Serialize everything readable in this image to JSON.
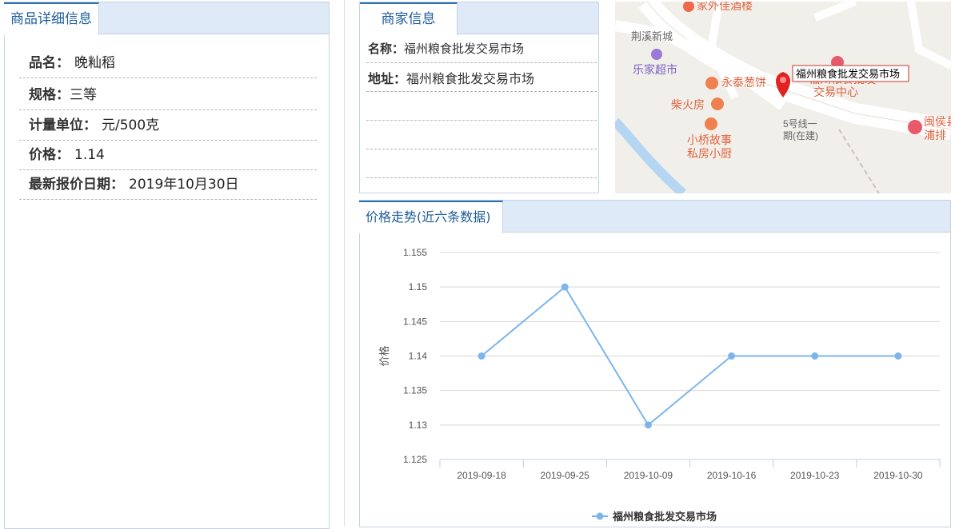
{
  "product": {
    "tab_title": "商品详细信息",
    "fields": [
      {
        "label": "品名：",
        "value": "晚籼稻"
      },
      {
        "label": "规格：",
        "value": "三等"
      },
      {
        "label": "计量单位：",
        "value": "元/500克"
      },
      {
        "label": "价格：",
        "value": "1.14"
      },
      {
        "label": "最新报价日期：",
        "value": "2019年10月30日"
      }
    ]
  },
  "merchant": {
    "tab_title": "商家信息",
    "name_label": "名称：",
    "name_value": "福州粮食批发交易市场",
    "address_label": "地址：",
    "address_value": "福州粮食批发交易市场"
  },
  "map": {
    "marker_label": "福州粮食批发交易市场",
    "pois": [
      "家外佳酒楼",
      "荆溪新城",
      "乐家超市",
      "永泰葱饼",
      "柴火房",
      "小桥故事",
      "私房小厨",
      "福州粮食批发",
      "交易中心",
      "5号线一",
      "期(在建)",
      "闽侯县",
      "浦排"
    ]
  },
  "chart_panel": {
    "tab_title": "价格走势(近六条数据)"
  },
  "chart_data": {
    "type": "line",
    "categories": [
      "2019-09-18",
      "2019-09-25",
      "2019-10-09",
      "2019-10-16",
      "2019-10-23",
      "2019-10-30"
    ],
    "series": [
      {
        "name": "福州粮食批发交易市场",
        "values": [
          1.14,
          1.15,
          1.13,
          1.14,
          1.14,
          1.14
        ]
      }
    ],
    "ylabel": "价格",
    "ylim": [
      1.125,
      1.155
    ],
    "yticks": [
      "1.155",
      "1.15",
      "1.145",
      "1.14",
      "1.135",
      "1.13",
      "1.125"
    ],
    "grid": true,
    "legend": "bottom-center",
    "line_color": "#7cb5ec"
  }
}
